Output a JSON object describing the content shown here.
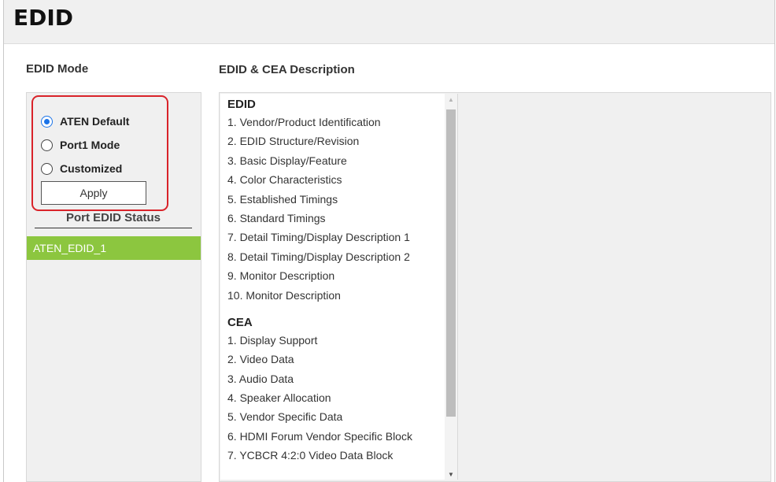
{
  "header": {
    "title": "EDID"
  },
  "edid_mode": {
    "label": "EDID Mode",
    "options": [
      {
        "label": "ATEN Default",
        "selected": true
      },
      {
        "label": "Port1 Mode",
        "selected": false
      },
      {
        "label": "Customized",
        "selected": false
      }
    ],
    "apply_label": "Apply",
    "status_label": "Port EDID Status",
    "ports": [
      {
        "label": "ATEN_EDID_1"
      }
    ],
    "highlight_color": "#d9232a",
    "port_color": "#8cc63f"
  },
  "description": {
    "label": "EDID & CEA Description",
    "groups": [
      {
        "title": "EDID",
        "items": [
          "1. Vendor/Product Identification",
          "2. EDID Structure/Revision",
          "3. Basic Display/Feature",
          "4. Color Characteristics",
          "5. Established Timings",
          "6. Standard Timings",
          "7. Detail Timing/Display Description 1",
          "8. Detail Timing/Display Description 2",
          "9. Monitor Description",
          "10. Monitor Description"
        ]
      },
      {
        "title": "CEA",
        "items": [
          "1. Display Support",
          "2. Video Data",
          "3. Audio Data",
          "4. Speaker Allocation",
          "5. Vendor Specific Data",
          "6. HDMI Forum Vendor Specific Block",
          "7. YCBCR 4:2:0 Video Data Block"
        ]
      }
    ]
  },
  "icons": {
    "scroll_up": "scroll-up-arrow-icon",
    "scroll_down": "scroll-down-arrow-icon"
  }
}
